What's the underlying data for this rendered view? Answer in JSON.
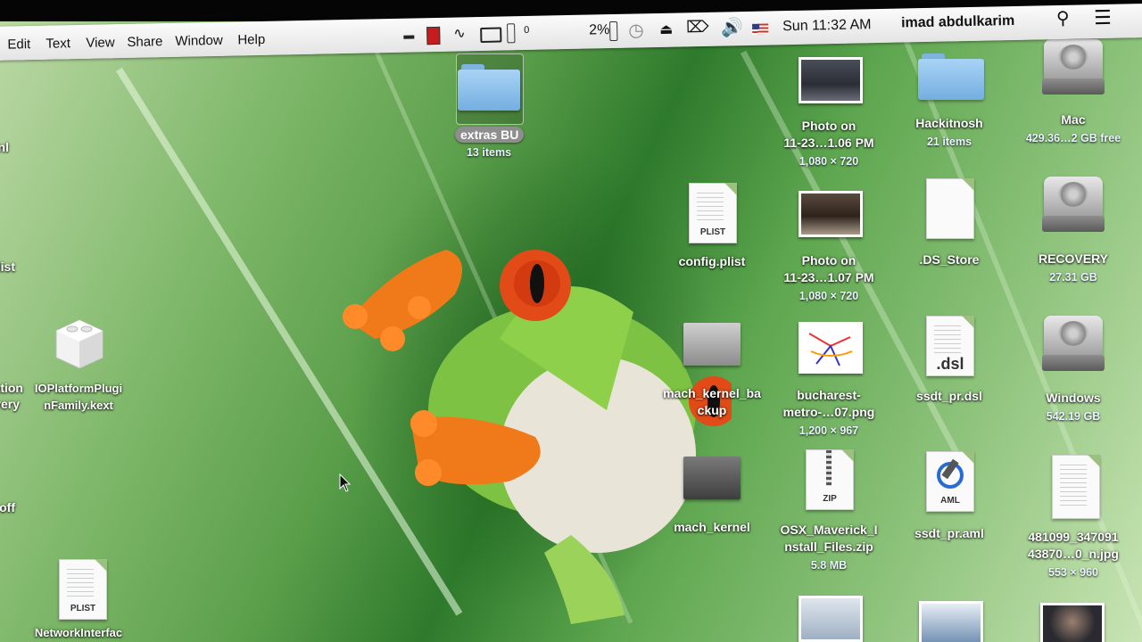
{
  "menubar": {
    "items": [
      "Edit",
      "Text",
      "View",
      "Share",
      "Window",
      "Help"
    ],
    "battery_percent": "2%",
    "counter": "0",
    "clock": "Sun 11:32 AM",
    "user": "imad abdulkarim",
    "status_icons": [
      "minus-icon",
      "red-box-icon",
      "activity-icon",
      "airplay-icon",
      "battery-gauge-icon",
      "time-machine-icon",
      "eject-icon",
      "delete-key-icon",
      "volume-icon",
      "us-flag-icon",
      "spotlight-icon",
      "list-icon"
    ]
  },
  "desktop": {
    "left_partial_labels": [
      "nl",
      "plist",
      "ation",
      "very",
      "off"
    ],
    "icons": [
      {
        "name": "extras BU",
        "sub": "13 items",
        "kind": "folder",
        "selected": true
      },
      {
        "name": "config.plist",
        "sub": "",
        "kind": "plist"
      },
      {
        "name": "mach_kernel_backup",
        "name_lines": [
          "mach_kernel_ba",
          "ckup"
        ],
        "sub": "",
        "kind": "kernel"
      },
      {
        "name": "mach_kernel",
        "sub": "",
        "kind": "kernel"
      },
      {
        "name": "IOPlatformPluginFamily.kext",
        "name_lines": [
          "IOPlatformPlugi",
          "nFamily.kext"
        ],
        "sub": "",
        "kind": "kext"
      },
      {
        "name": "NetworkInterfac",
        "sub": "",
        "kind": "plist"
      },
      {
        "name_lines": [
          "Photo on",
          "11-23…1.06 PM"
        ],
        "sub": "1,080 × 720",
        "kind": "photo"
      },
      {
        "name_lines": [
          "Photo on",
          "11-23…1.07 PM"
        ],
        "sub": "1,080 × 720",
        "kind": "photo"
      },
      {
        "name_lines": [
          "bucharest-",
          "metro-…07.png"
        ],
        "sub": "1,200 × 967",
        "kind": "png"
      },
      {
        "name_lines": [
          "OSX_Maverick_I",
          "nstall_Files.zip"
        ],
        "sub": "5.8 MB",
        "kind": "zip"
      },
      {
        "name": "Hackitnosh",
        "sub": "21 items",
        "kind": "folder"
      },
      {
        "name": ".DS_Store",
        "sub": "",
        "kind": "doc"
      },
      {
        "name": "ssdt_pr.dsl",
        "sub": "",
        "kind": "dsl"
      },
      {
        "name": "ssdt_pr.aml",
        "sub": "",
        "kind": "aml"
      },
      {
        "name": "Mac",
        "sub": "429.36…2 GB free",
        "kind": "disk"
      },
      {
        "name": "RECOVERY",
        "sub": "27.31 GB",
        "kind": "disk"
      },
      {
        "name": "Windows",
        "sub": "542.19 GB",
        "kind": "disk"
      },
      {
        "name_lines": [
          "481099_347091",
          "43870…0_n.jpg"
        ],
        "sub": "553 × 960",
        "kind": "jpg"
      }
    ],
    "file_tags": {
      "plist": "PLIST",
      "dsl": ".dsl",
      "zip": "ZIP",
      "aml": "AML"
    }
  }
}
